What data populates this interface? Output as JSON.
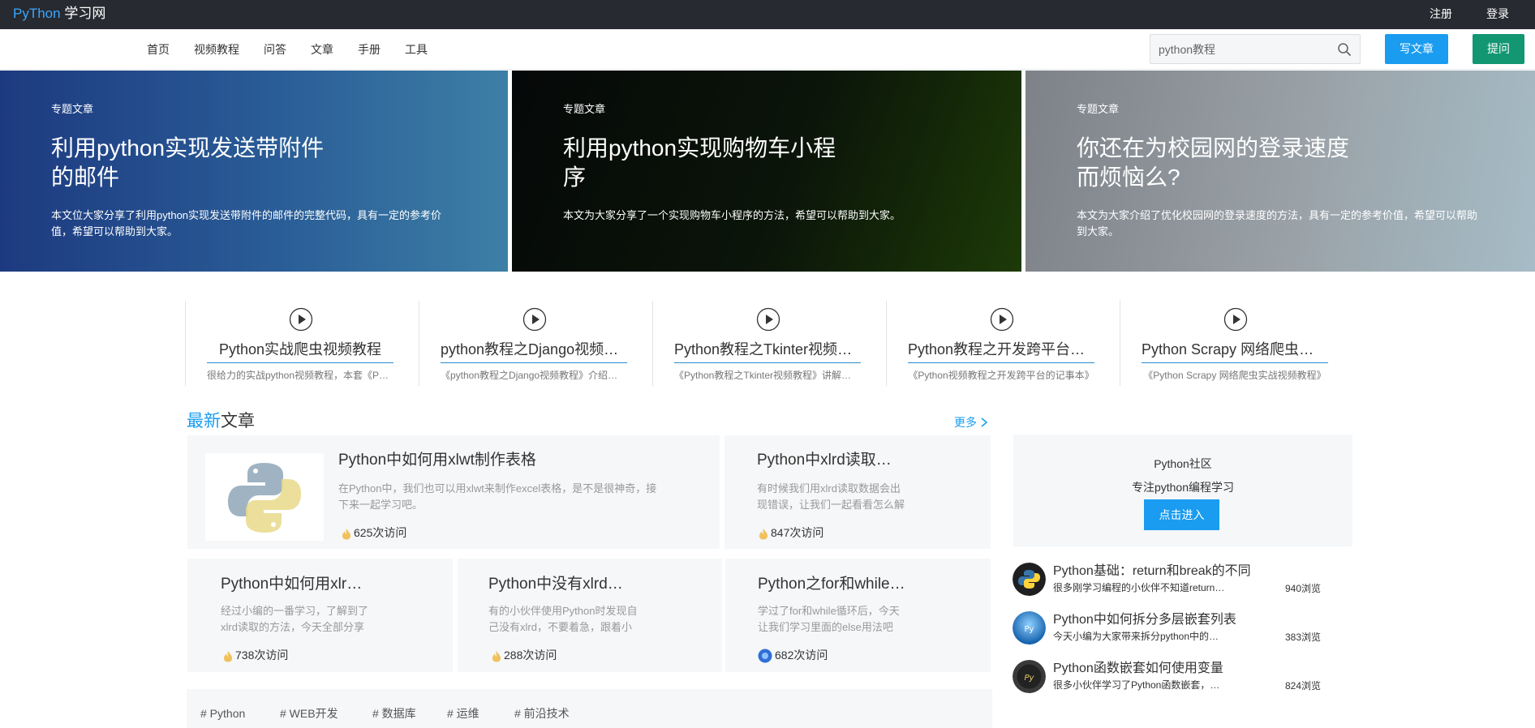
{
  "topbar": {
    "logo_brand": "PyThon",
    "logo_suffix": " 学习网",
    "register": "注册",
    "login": "登录"
  },
  "nav": {
    "items": [
      "首页",
      "视频教程",
      "问答",
      "文章",
      "手册",
      "工具"
    ],
    "search_value": "python教程",
    "write_button": "写文章",
    "ask_button": "提问"
  },
  "hero": [
    {
      "tag": "专题文章",
      "title": "利用python实现发送带附件的邮件",
      "desc": "本文位大家分享了利用python实现发送带附件的邮件的完整代码，具有一定的参考价值，希望可以帮助到大家。"
    },
    {
      "tag": "专题文章",
      "title": "利用python实现购物车小程序",
      "desc": "本文为大家分享了一个实现购物车小程序的方法，希望可以帮助到大家。"
    },
    {
      "tag": "专题文章",
      "title": "你还在为校园网的登录速度而烦恼么?",
      "desc": "本文为大家介绍了优化校园网的登录速度的方法，具有一定的参考价值，希望可以帮助到大家。"
    }
  ],
  "videos": [
    {
      "title": "Python实战爬虫视频教程",
      "desc": "很给力的实战python视频教程，本套《Python实战爬虫视频教程》"
    },
    {
      "title": "python教程之Django视频教程",
      "desc": "《python教程之Django视频教程》介绍了Django的使用方法"
    },
    {
      "title": "Python教程之Tkinter视频教程",
      "desc": "《Python教程之Tkinter视频教程》讲解了Tkinter的用法"
    },
    {
      "title": "Python教程之开发跨平台的记事本",
      "desc": "《Python视频教程之开发跨平台的记事本》"
    },
    {
      "title": "Python Scrapy 网络爬虫实战视频教程",
      "desc": "《Python Scrapy 网络爬虫实战视频教程》"
    }
  ],
  "latest": {
    "title_highlight": "最新",
    "title_rest": "文章",
    "more": "更多",
    "featured": {
      "title": "Python中如何用xlwt制作表格",
      "desc": "在Python中，我们也可以用xlwt来制作excel表格，是不是很神奇，接下来一起学习吧。",
      "visits": "625次访问"
    },
    "cards": [
      {
        "title": "Python中xlrd读取的数据出现错误",
        "desc": "有时候我们用xlrd读取数据会出现错误，让我们一起看看怎么解决吧",
        "visits": "847次访问"
      },
      {
        "title": "Python中如何用xlrd读取数据",
        "desc": "经过小编的一番学习，了解到了xlrd读取的方法，今天全部分享给大家",
        "visits": "738次访问"
      },
      {
        "title": "Python中没有xlrd怎么办",
        "desc": "有的小伙伴使用Python时发现自己没有xlrd，不要着急，跟着小编来看看",
        "visits": "288次访问"
      },
      {
        "title": "Python之for和while循环",
        "desc": "学过了for和while循环后，今天让我们学习里面的else用法吧",
        "visits": "682次访问"
      }
    ]
  },
  "tags": [
    "# Python",
    "# WEB开发",
    "# 数据库",
    "# 运维",
    "# 前沿技术"
  ],
  "community": {
    "name": "Python社区",
    "slogan": "专注python编程学习",
    "button": "点击进入"
  },
  "recommended": [
    {
      "title": "Python基础：return和break的不同",
      "desc": "很多刚学习编程的小伙伴不知道return和break的区别",
      "views": "940浏览"
    },
    {
      "title": "Python中如何拆分多层嵌套列表",
      "desc": "今天小编为大家带来拆分python中的多层嵌套列表",
      "views": "383浏览"
    },
    {
      "title": "Python函数嵌套如何使用变量",
      "desc": "很多小伙伴学习了Python函数嵌套，但是不知道如何使用变量",
      "views": "824浏览"
    }
  ],
  "colors": {
    "accent_blue": "#1a9cf0",
    "accent_green": "#139672",
    "topbar": "#272a30"
  }
}
